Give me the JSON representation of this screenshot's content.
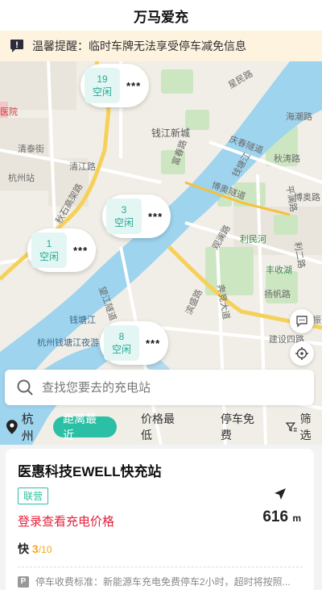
{
  "app": {
    "title": "万马爱充"
  },
  "notice": {
    "text": "温馨提醒：临时车牌无法享受停车减免信息"
  },
  "map": {
    "labels": [
      "医院",
      "清泰街",
      "杭州站",
      "清江路",
      "秋石高架路",
      "钱江新城",
      "富春路",
      "庆春隧道",
      "钱塘江",
      "博奥隧道",
      "海潮路",
      "秋涛路",
      "利民河",
      "观澜路",
      "望江隧道",
      "杭州钱塘江夜游",
      "钱塘江",
      "滨盛路",
      "扬帆路",
      "建设四路",
      "奔竞大道",
      "博奥路",
      "平澜路",
      "利二路",
      "丰收湖",
      "振宁路",
      "星民路"
    ],
    "pins": [
      {
        "count": "19",
        "status": "空闲",
        "stars": "***"
      },
      {
        "count": "3",
        "status": "空闲",
        "stars": "***"
      },
      {
        "count": "1",
        "status": "空闲",
        "stars": "***"
      },
      {
        "count": "8",
        "status": "空闲",
        "stars": "***"
      }
    ]
  },
  "search": {
    "placeholder": "查找您要去的充电站"
  },
  "filters": {
    "city": "杭州",
    "options": [
      "距离最近",
      "价格最低",
      "停车免费"
    ],
    "filter_label": "筛选"
  },
  "station": {
    "name": "医惠科技EWELL快充站",
    "badge": "联营",
    "price_link": "登录查看充电价格",
    "fast_label": "快",
    "fast_available": "3",
    "fast_total": "/10",
    "distance": "616",
    "distance_unit": "m",
    "parking_text": "停车收费标准：新能源车充电免费停车2小时，超时将按照..."
  },
  "colors": {
    "accent": "#2bbfa5",
    "warning": "#e3213b",
    "notice_bg": "#fdf3de"
  }
}
